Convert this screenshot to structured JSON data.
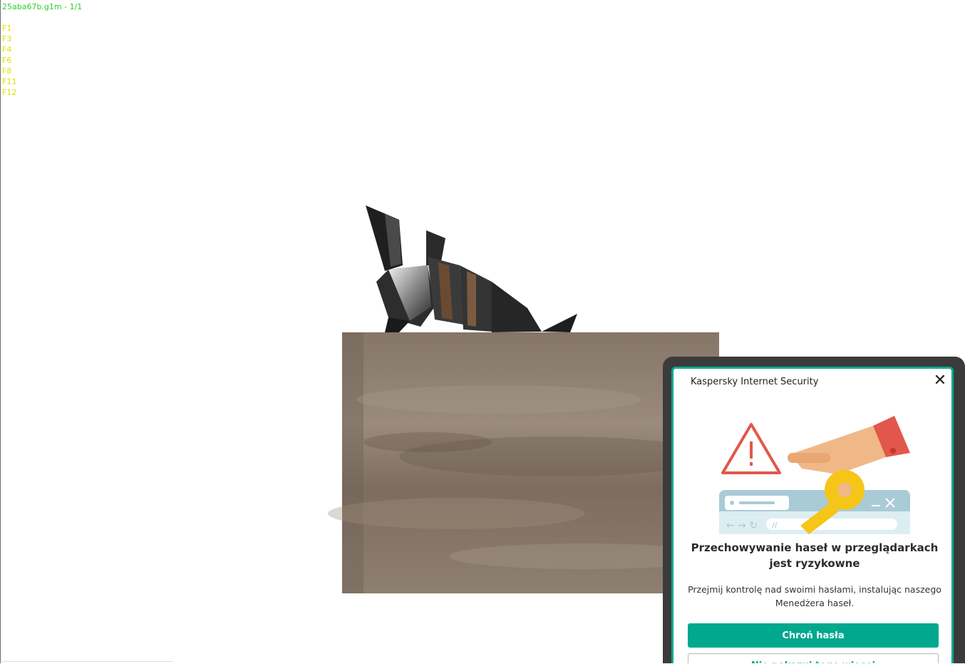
{
  "viewer": {
    "title": "25aba67b.g1m - 1/1",
    "keys": [
      "F1",
      "F3",
      "F4",
      "F6",
      "F8",
      "F11",
      "F12"
    ]
  },
  "popup": {
    "app_title": "Kaspersky Internet Security",
    "close_icon": "close-icon",
    "headline": "Przechowywanie haseł w przeglądarkach jest ryzykowne",
    "description": "Przejmij kontrolę nad swoimi hasłami, instalując naszego Menedżera haseł.",
    "primary_label": "Chroń hasła",
    "secondary_label": "Nie pokazuj tego więcej",
    "accent_color": "#00a88e",
    "warning_color": "#e2574c",
    "key_color": "#f5c518"
  }
}
